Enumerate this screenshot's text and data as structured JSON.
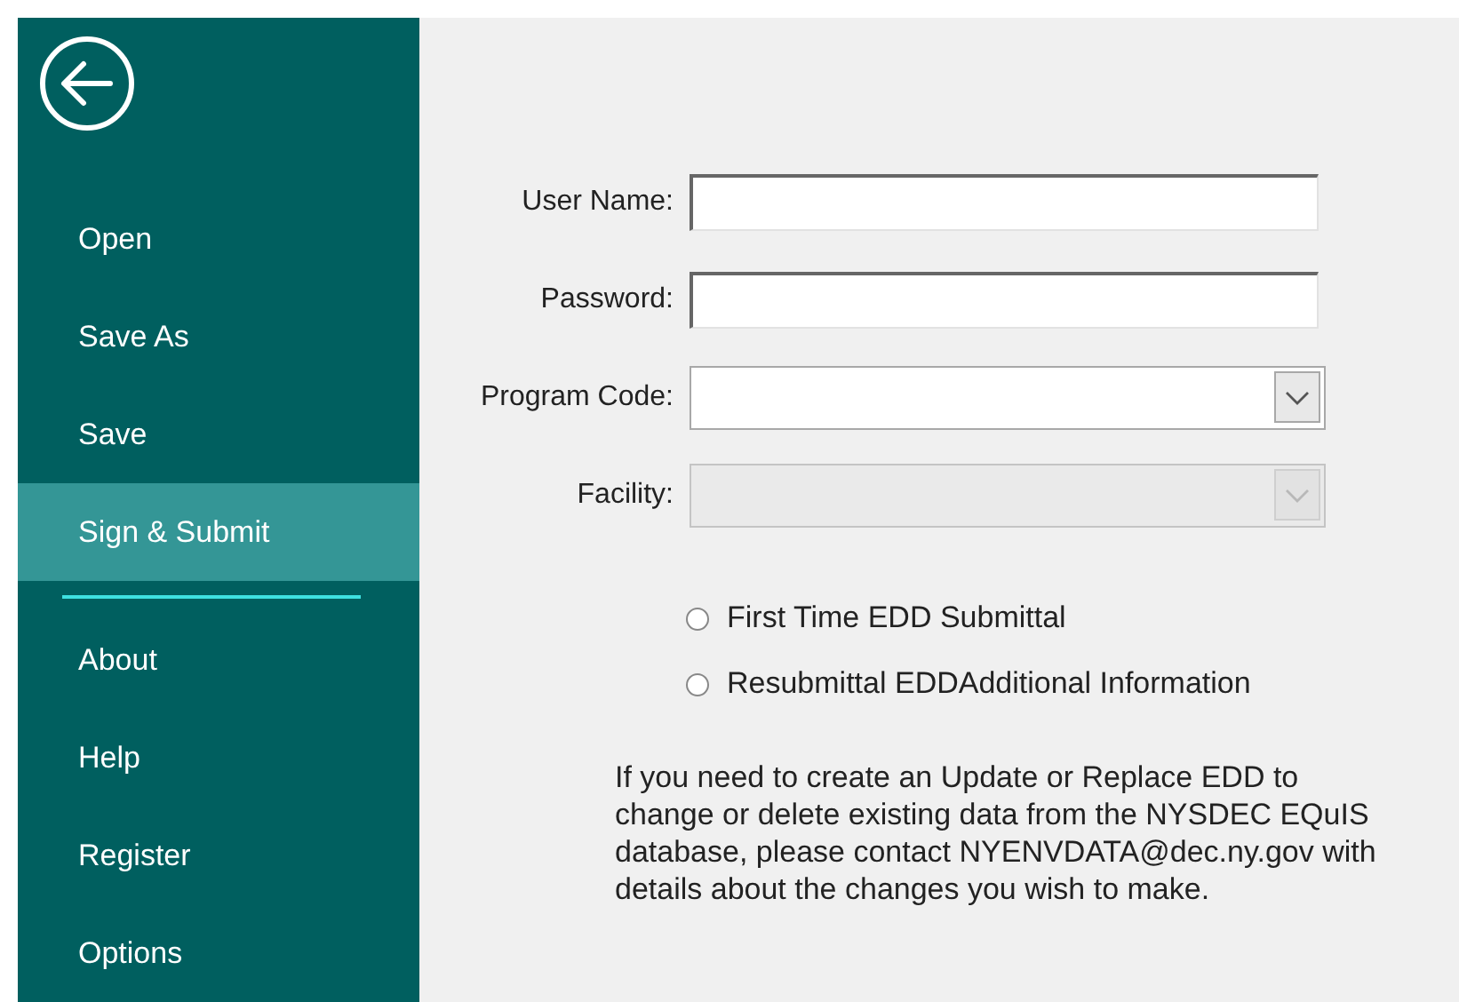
{
  "sidebar": {
    "items": [
      {
        "kind": "item",
        "label": "Open",
        "selected": false
      },
      {
        "kind": "item",
        "label": "Save As",
        "selected": false
      },
      {
        "kind": "item",
        "label": "Save",
        "selected": false
      },
      {
        "kind": "item",
        "label": "Sign & Submit",
        "selected": true
      },
      {
        "kind": "separator"
      },
      {
        "kind": "item",
        "label": "About",
        "selected": false
      },
      {
        "kind": "item",
        "label": "Help",
        "selected": false
      },
      {
        "kind": "item",
        "label": "Register",
        "selected": false
      },
      {
        "kind": "item",
        "label": "Options",
        "selected": false
      }
    ]
  },
  "form": {
    "fields": [
      {
        "kind": "text",
        "label": "User Name:",
        "disabled": false
      },
      {
        "kind": "text",
        "label": "Password:",
        "disabled": false
      },
      {
        "kind": "combo",
        "label": "Program Code:",
        "disabled": false
      },
      {
        "kind": "combo",
        "label": "Facility:",
        "disabled": true
      }
    ],
    "options": [
      {
        "label": "First Time EDD Submittal",
        "selected": false
      },
      {
        "label": "Resubmittal EDDAdditional Information",
        "selected": false
      }
    ],
    "note": "If you need to create an Update or Replace EDD to change or delete existing data from the NYSDEC EQuIS database, please contact NYENVDATA@dec.ny.gov with details about the changes you wish to make."
  }
}
